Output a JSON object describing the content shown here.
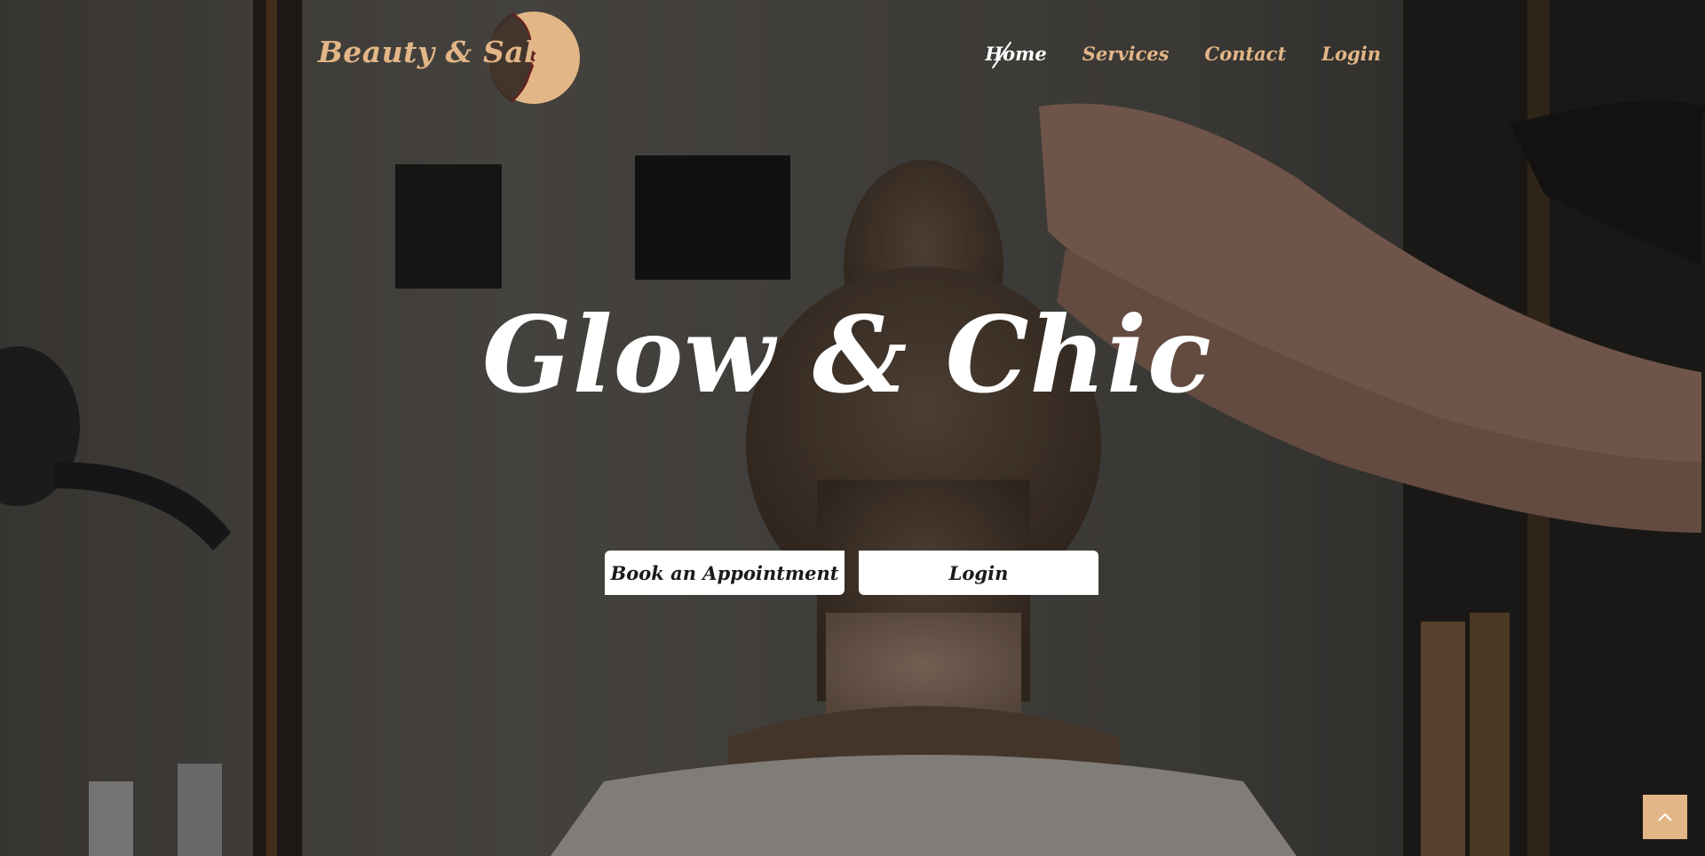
{
  "header": {
    "logo_text": "Beauty & Salon",
    "logo_icon": "woman-profile-moon-icon"
  },
  "nav": {
    "items": [
      {
        "label": "Home",
        "active": true
      },
      {
        "label": "Services",
        "active": false
      },
      {
        "label": "Contact",
        "active": false
      },
      {
        "label": "Login",
        "active": false
      }
    ]
  },
  "hero": {
    "title": "Glow & Chic",
    "buttons": {
      "book_label": "Book an Appointment",
      "login_label": "Login"
    }
  },
  "scroll_top": {
    "icon": "chevron-up-icon"
  },
  "colors": {
    "accent": "#e3b687",
    "text_light": "#ffffff",
    "button_bg": "#ffffff",
    "button_text": "#1a1a1a"
  }
}
